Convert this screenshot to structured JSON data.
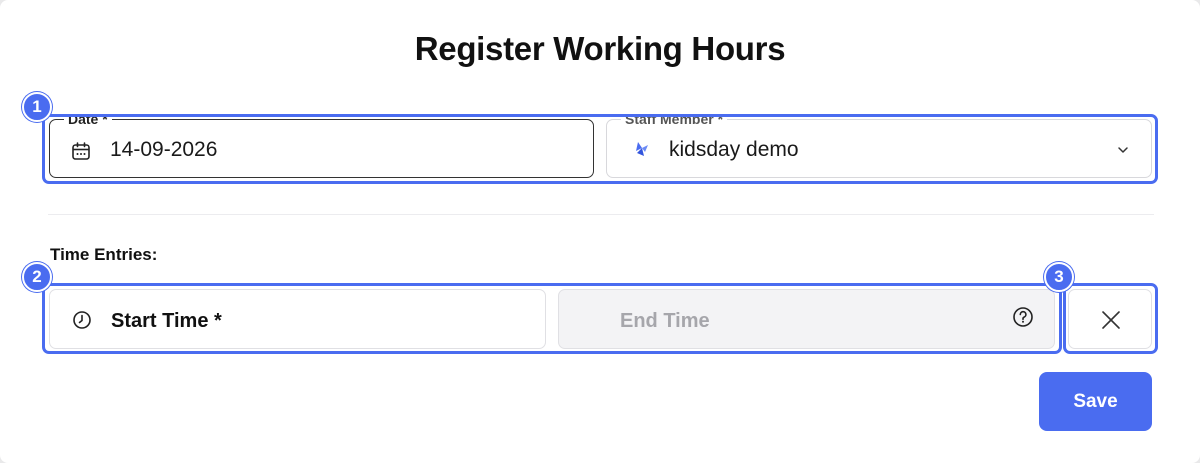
{
  "dialog": {
    "title": "Register Working Hours"
  },
  "date_field": {
    "label": "Date *",
    "value": "14-09-2026",
    "icon": "calendar-icon"
  },
  "staff_field": {
    "label": "Staff Member *",
    "value": "kidsday demo",
    "icon": "staff-logo-icon",
    "dropdown_icon": "chevron-down-icon"
  },
  "time_entries": {
    "label": "Time Entries:",
    "start_placeholder": "Start Time *",
    "end_placeholder": "End Time",
    "help_icon": "question-circle-icon",
    "remove_icon": "close-icon"
  },
  "annotations": [
    {
      "label": "1"
    },
    {
      "label": "2"
    },
    {
      "label": "3"
    }
  ],
  "actions": {
    "save_label": "Save"
  },
  "colors": {
    "accent": "#4a6cf0",
    "disabled_bg": "#f3f3f5",
    "disabled_text": "#a6a6ab"
  }
}
